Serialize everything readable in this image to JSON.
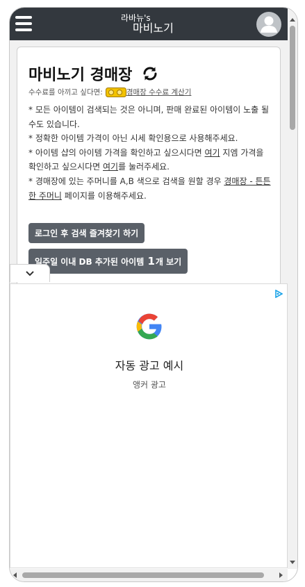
{
  "header": {
    "brand_small": "라바뉴's",
    "brand_big": "마비노기",
    "menu_icon": "hamburger-icon",
    "avatar_icon": "user-avatar-icon"
  },
  "main": {
    "title": "마비노기 경매장",
    "refresh_icon": "refresh-icon",
    "fee_prefix": "수수료를 아끼고 싶다면:",
    "fee_link": "경매장 수수료 계산기",
    "notes": [
      "* 모든 아이템이 검색되는 것은 아니며, 판매 완료된 아이템이 노출 될 수도 있습니다.",
      "* 정확한 아이템 가격이 아닌 시세 확인용으로 사용해주세요."
    ],
    "note3_a": "* 아이템 샵의 아이템 가격을 확인하고 싶으시다면 ",
    "note3_link1": "여기",
    "note3_b": " 지엠 가격을 확인하고 싶으시다면 ",
    "note3_link2": "여기",
    "note3_c": "를 눌러주세요.",
    "note4_a": "* 경매장에 있는 주머니를 A,B 색으로 검색을 원할 경우 ",
    "note4_link": "경매장 - 튼튼한 주머니",
    "note4_b": " 페이지를 이용해주세요.",
    "btn_login_fav": "로그인 후 검색 즐겨찾기 하기",
    "btn_recent_prefix": "일주일 이내 DB 추가된 아이템",
    "btn_recent_count": "1",
    "btn_recent_suffix": "개 보기"
  },
  "ad": {
    "title": "자동 광고 예시",
    "subtitle": "앵커 광고",
    "logo": "google-logo"
  },
  "colors": {
    "header_bg": "#33383e",
    "button_bg": "#5a6068",
    "page_bg": "#f1f1f1"
  }
}
